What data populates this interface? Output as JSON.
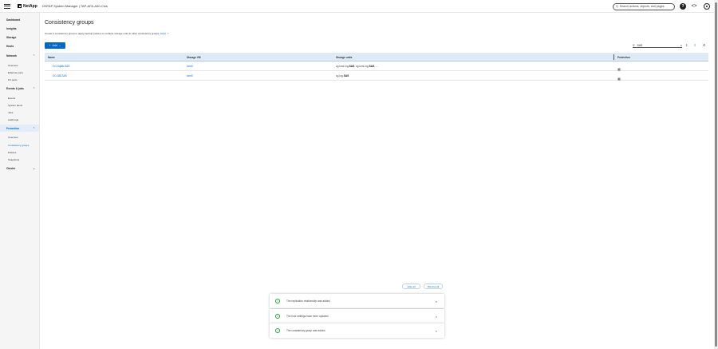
{
  "header": {
    "brand": "NetApp",
    "app_title": "ONTAP System Manager | TAP-AFA-A50-Clus",
    "search_placeholder": "Search actions, objects, and pages"
  },
  "sidebar": {
    "items": [
      {
        "label": "Dashboard",
        "type": "top"
      },
      {
        "label": "Insights",
        "type": "top"
      },
      {
        "label": "Storage",
        "type": "top"
      },
      {
        "label": "Hosts",
        "type": "top"
      },
      {
        "label": "Network",
        "type": "top",
        "chevron": "chevron-up"
      },
      {
        "label": "Overview",
        "type": "sub"
      },
      {
        "label": "Ethernet ports",
        "type": "sub"
      },
      {
        "label": "FC ports",
        "type": "sub"
      },
      {
        "label": "Events & jobs",
        "type": "top",
        "chevron": "chevron-up"
      },
      {
        "label": "Events",
        "type": "sub"
      },
      {
        "label": "System alerts",
        "type": "sub"
      },
      {
        "label": "Jobs",
        "type": "sub"
      },
      {
        "label": "Audit logs",
        "type": "sub"
      },
      {
        "label": "Protection",
        "type": "top",
        "chevron": "chevron-up",
        "active": true
      },
      {
        "label": "Overview",
        "type": "sub"
      },
      {
        "label": "Consistency groups",
        "type": "sub",
        "selected": true
      },
      {
        "label": "Policies",
        "type": "sub"
      },
      {
        "label": "Snapshots",
        "type": "sub"
      },
      {
        "label": "Cluster",
        "type": "top",
        "chevron": "chevron-down"
      }
    ]
  },
  "page": {
    "title": "Consistency groups",
    "description": "Create a consistency group to apply backup policies to multiple storage units in other consistency groups.",
    "more_link": "More",
    "add_label": "Add",
    "filter_value": "SAS"
  },
  "table": {
    "columns": [
      "Name",
      "Storage VM",
      "Storage units",
      "Protection"
    ],
    "rows": [
      {
        "name": "CG-Sqldb-SAS",
        "svm": "svm0",
        "units_pre": "cg-luns-log-",
        "units_b1": "SAS",
        "units_mid": ", cg-luns-log-",
        "units_b2": "SAS",
        "units_post": ", ..."
      },
      {
        "name": "CG-DB-SAS",
        "svm": "svm0",
        "units_pre": "cg-log-",
        "units_b1": "SAS",
        "units_mid": "",
        "units_b2": "",
        "units_post": ""
      }
    ]
  },
  "toasts": {
    "hide_all": "Hide all",
    "dismiss_all": "Dismiss all",
    "messages": [
      "The replication relationship was added.",
      "The host settings have been updated.",
      "The consistency group was added."
    ]
  },
  "colors": {
    "accent": "#0067c5",
    "success": "#2a9d3f",
    "header_row": "#dfeaf7"
  }
}
